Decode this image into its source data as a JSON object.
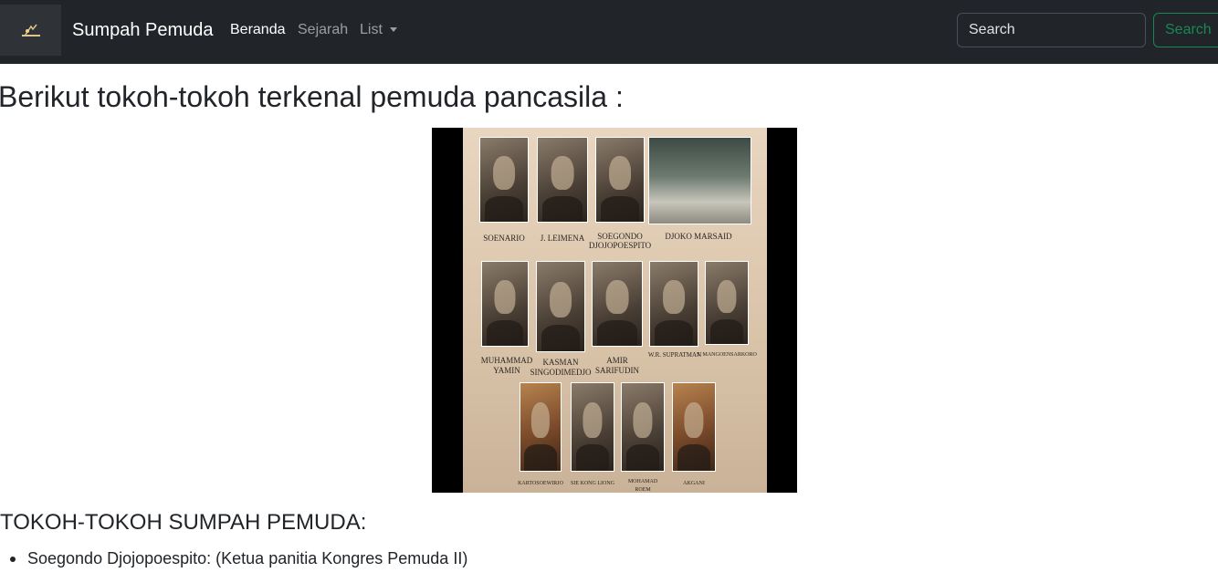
{
  "navbar": {
    "brand": "Sumpah Pemuda",
    "links": [
      {
        "label": "Beranda",
        "active": true
      },
      {
        "label": "Sejarah",
        "active": false
      },
      {
        "label": "List",
        "active": false
      }
    ],
    "search_placeholder": "Search",
    "search_button": "Search"
  },
  "main": {
    "title": "Berikut tokoh-tokoh terkenal pemuda pancasila :",
    "image_captions": [
      "SOENARIO",
      "J. LEIMENA",
      "SOEGONDO",
      "DJOJOPOESPITO",
      "DJOKO MARSAID",
      "MUHAMMAD",
      "YAMIN",
      "KASMAN",
      "SINGODIMEDJO",
      "AMIR",
      "SARIFUDIN",
      "W.R. SUPRATMAN",
      "S. MANGOENSARKORO",
      "KARTOSOEWIRJO",
      "SIE KONG LIONG",
      "MOHAMAD",
      "ROEM",
      "AKGANI"
    ],
    "section_heading": "TOKOH-TOKOH SUMPAH PEMUDA:",
    "list_items": [
      "Soegondo Djojopoespito: (Ketua panitia Kongres Pemuda II)"
    ]
  },
  "colors": {
    "navbar_bg": "#212529",
    "success": "#198754"
  }
}
